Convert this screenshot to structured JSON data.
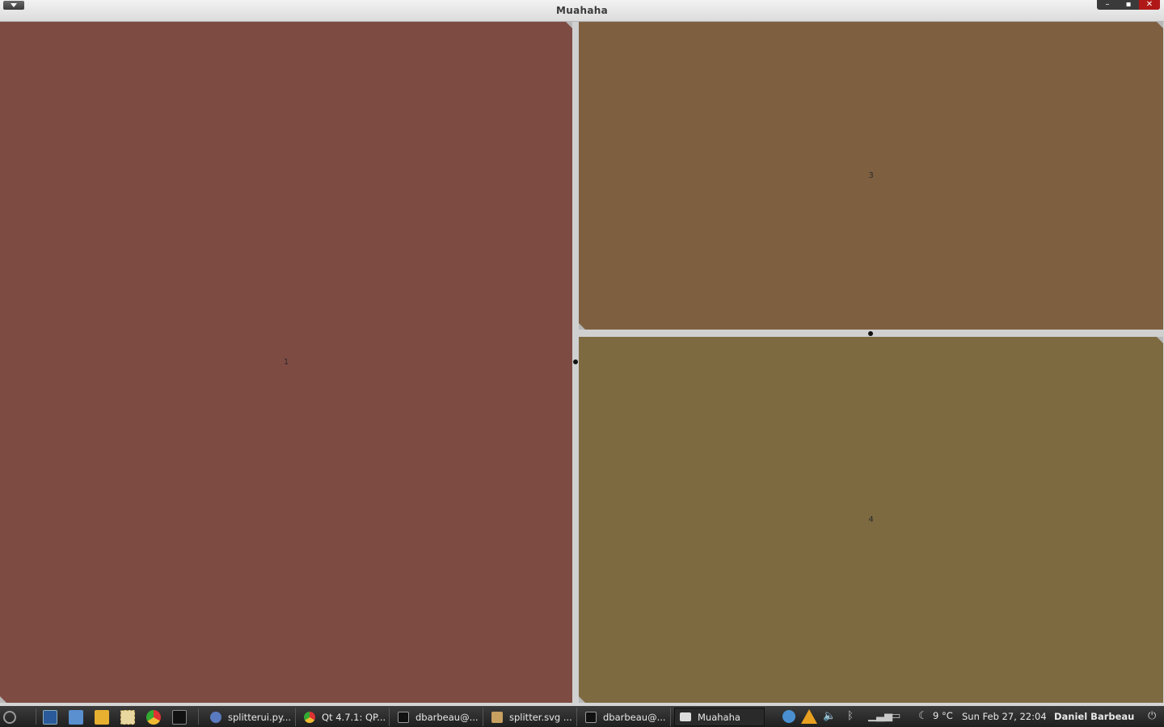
{
  "window": {
    "title": "Muahaha",
    "controls": {
      "minimize": "–",
      "maximize": "▪",
      "close": "✕"
    }
  },
  "panes": [
    {
      "label": "1",
      "color": "#7e4b43"
    },
    {
      "label": "3",
      "color": "#7e6041"
    },
    {
      "label": "4",
      "color": "#7e6a41"
    }
  ],
  "taskbar": {
    "launchers": [
      "system-menu-icon",
      "terminal-app-icon",
      "home-folder-icon",
      "file-manager-icon",
      "text-editor-icon",
      "chrome-icon",
      "terminal-icon"
    ],
    "tasks": [
      {
        "label": "splitterui.py...",
        "icon": "python-editor-icon",
        "active": false
      },
      {
        "label": "Qt 4.7.1: QP...",
        "icon": "chrome-icon",
        "active": false
      },
      {
        "label": "dbarbeau@...",
        "icon": "terminal-icon",
        "active": false
      },
      {
        "label": "splitter.svg ...",
        "icon": "inkscape-icon",
        "active": false
      },
      {
        "label": "dbarbeau@...",
        "icon": "terminal-icon",
        "active": false
      },
      {
        "label": "Muahaha",
        "icon": "window-icon",
        "active": true
      }
    ],
    "weather": "9 °C",
    "clock": "Sun Feb 27, 22:04",
    "user": "Daniel Barbeau"
  }
}
